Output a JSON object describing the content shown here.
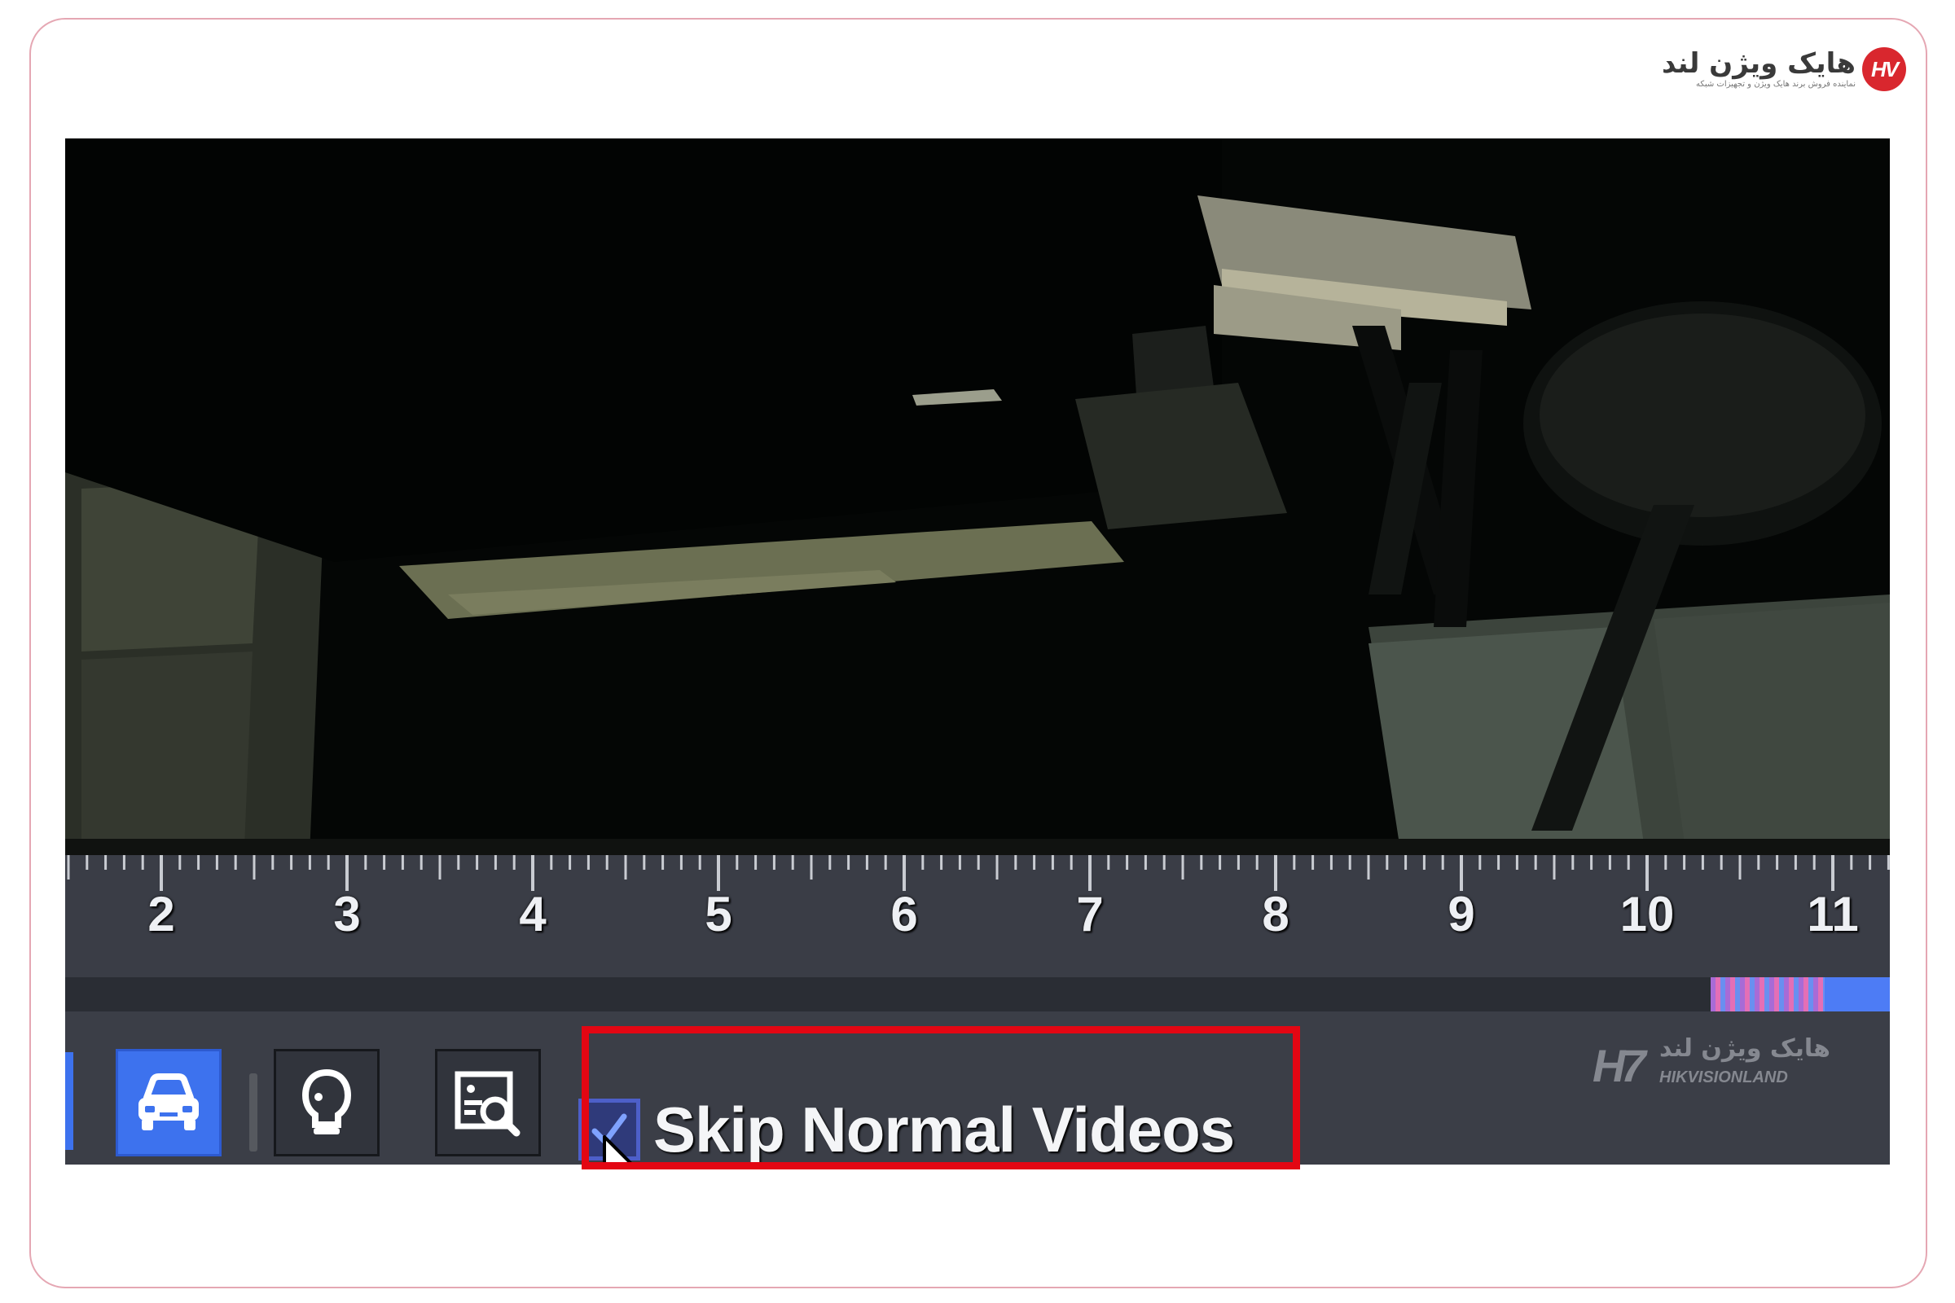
{
  "brand": {
    "name": "هایک ویژن لند",
    "tagline": "نماینده فروش برند هایک ویژن و تجهیزات شبکه",
    "badge": "HV"
  },
  "timeline": {
    "hour_labels": [
      "2",
      "3",
      "4",
      "5",
      "6",
      "7",
      "8",
      "9",
      "10",
      "11"
    ],
    "recording_colors": [
      "#a86bd6",
      "#e46fb6",
      "#6a8ff0",
      "#4d7cf5"
    ]
  },
  "toolbar": {
    "buttons": [
      "vehicle",
      "human",
      "smart-search"
    ],
    "active_button": "vehicle",
    "skip_normal_videos": {
      "label": "Skip Normal Videos",
      "checked": true
    }
  },
  "watermark": {
    "mark": "H7",
    "text_fa": "هایک ویژن لند",
    "text_en": "HIKVISIONLAND"
  },
  "annotation": {
    "highlight_color": "#e30613"
  }
}
